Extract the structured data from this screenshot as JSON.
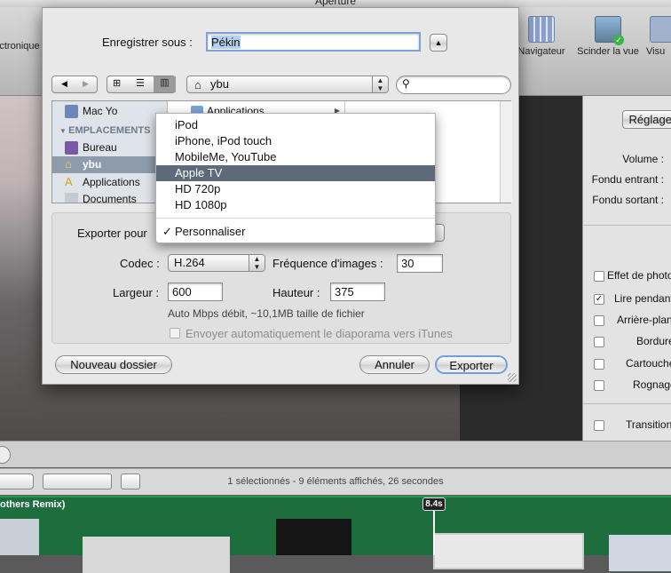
{
  "app": {
    "title": "Aperture"
  },
  "toolbar": {
    "left_fragment": "ctronique",
    "navigateur": "Navigateur",
    "scinder": "Scinder la vue",
    "visu": "Visu"
  },
  "sheet": {
    "save_as_label": "Enregistrer sous :",
    "filename": "Pékin",
    "location": "ybu",
    "search_placeholder": "",
    "sidebar": {
      "device": "Mac Yo",
      "section": "EMPLACEMENTS",
      "items": [
        "Bureau",
        "ybu",
        "Applications",
        "Documents"
      ]
    },
    "column_item": "Applications",
    "export_for_label": "Exporter pour",
    "codec_label": "Codec :",
    "codec_value": "H.264",
    "fps_label": "Fréquence d'images :",
    "fps_value": "30",
    "width_label": "Largeur :",
    "width_value": "600",
    "height_label": "Hauteur :",
    "height_value": "375",
    "bitrate_info": "Auto Mbps débit, ~10,1MB taille de fichier",
    "itunes_label": "Envoyer automatiquement le diaporama vers iTunes",
    "new_folder": "Nouveau dossier",
    "cancel": "Annuler",
    "export": "Exporter"
  },
  "menu": {
    "items": [
      "iPod",
      "iPhone, iPod touch",
      "MobileMe, YouTube",
      "Apple TV",
      "HD 720p",
      "HD 1080p"
    ],
    "selected_index": 3,
    "custom": "Personnaliser",
    "custom_checked": "✓"
  },
  "inspector": {
    "button": "Réglages",
    "volume": "Volume :",
    "fade_in": "Fondu entrant :",
    "fade_out": "Fondu sortant :",
    "checks": [
      "Effet de photo",
      "Lire pendant",
      "Arrière-plan",
      "Bordure",
      "Cartouche",
      "Rognage",
      "Transition"
    ]
  },
  "status": {
    "summary": "1 sélectionnés - 9 éléments affichés, 26 secondes"
  },
  "timeline": {
    "track_label": "others Remix)",
    "playhead": "8.4s"
  }
}
